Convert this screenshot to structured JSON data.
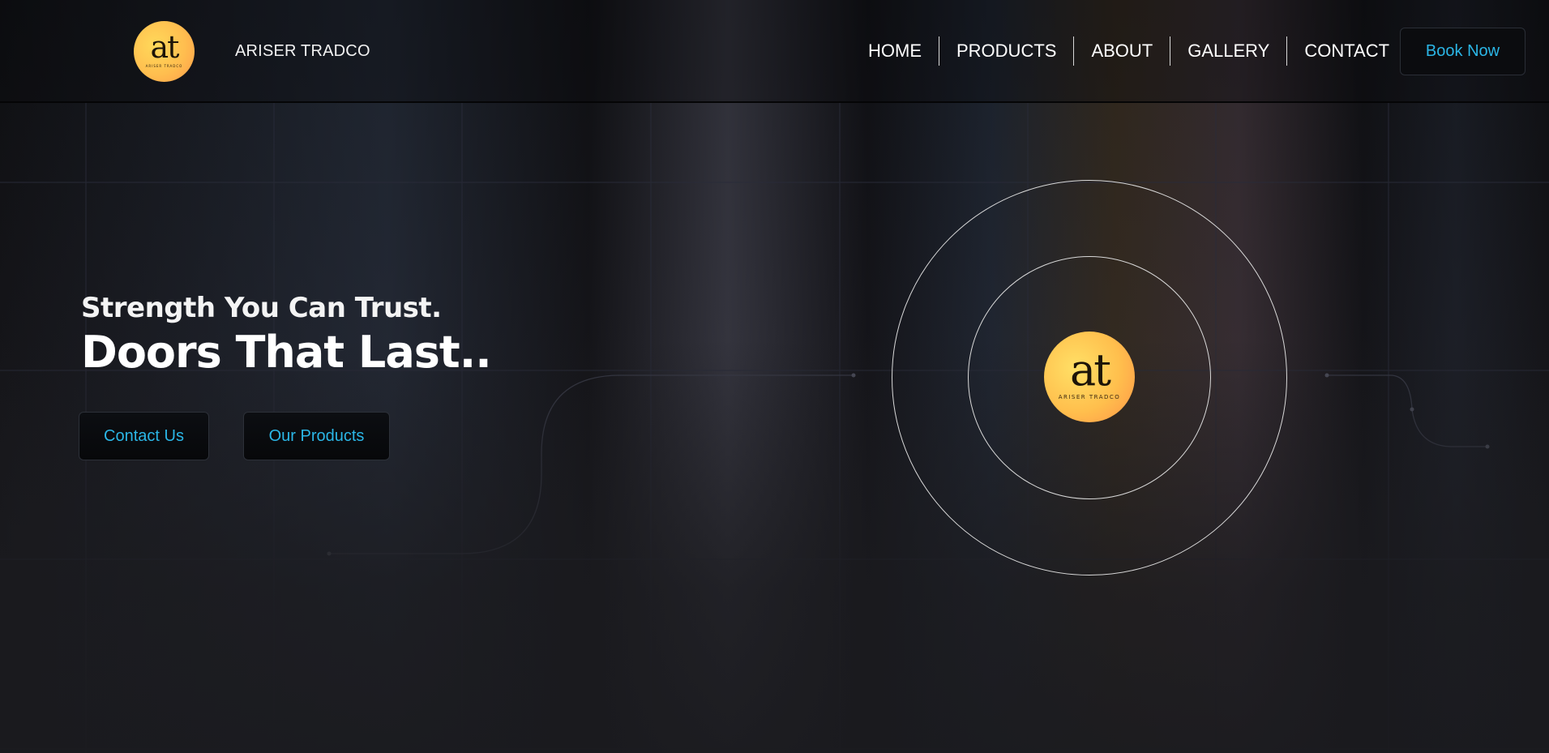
{
  "header": {
    "logo": {
      "mark": "at",
      "sub": "ARISER TRADCO"
    },
    "brand_name": "ARISER TRADCO",
    "nav": [
      {
        "label": "HOME"
      },
      {
        "label": "PRODUCTS"
      },
      {
        "label": "ABOUT"
      },
      {
        "label": "GALLERY"
      },
      {
        "label": "CONTACT"
      }
    ],
    "book_button": "Book Now"
  },
  "hero": {
    "subtitle": "Strength You Can Trust.",
    "title": "Doors That Last..",
    "buttons": {
      "contact": "Contact Us",
      "products": "Our Products"
    }
  },
  "emblem": {
    "mark": "at",
    "sub": "ARISER TRADCO"
  },
  "colors": {
    "accent": "#2bb6e6",
    "logo_gradient_start": "#ffd95a",
    "logo_gradient_end": "#ff9b4a",
    "background": "#16161a"
  }
}
